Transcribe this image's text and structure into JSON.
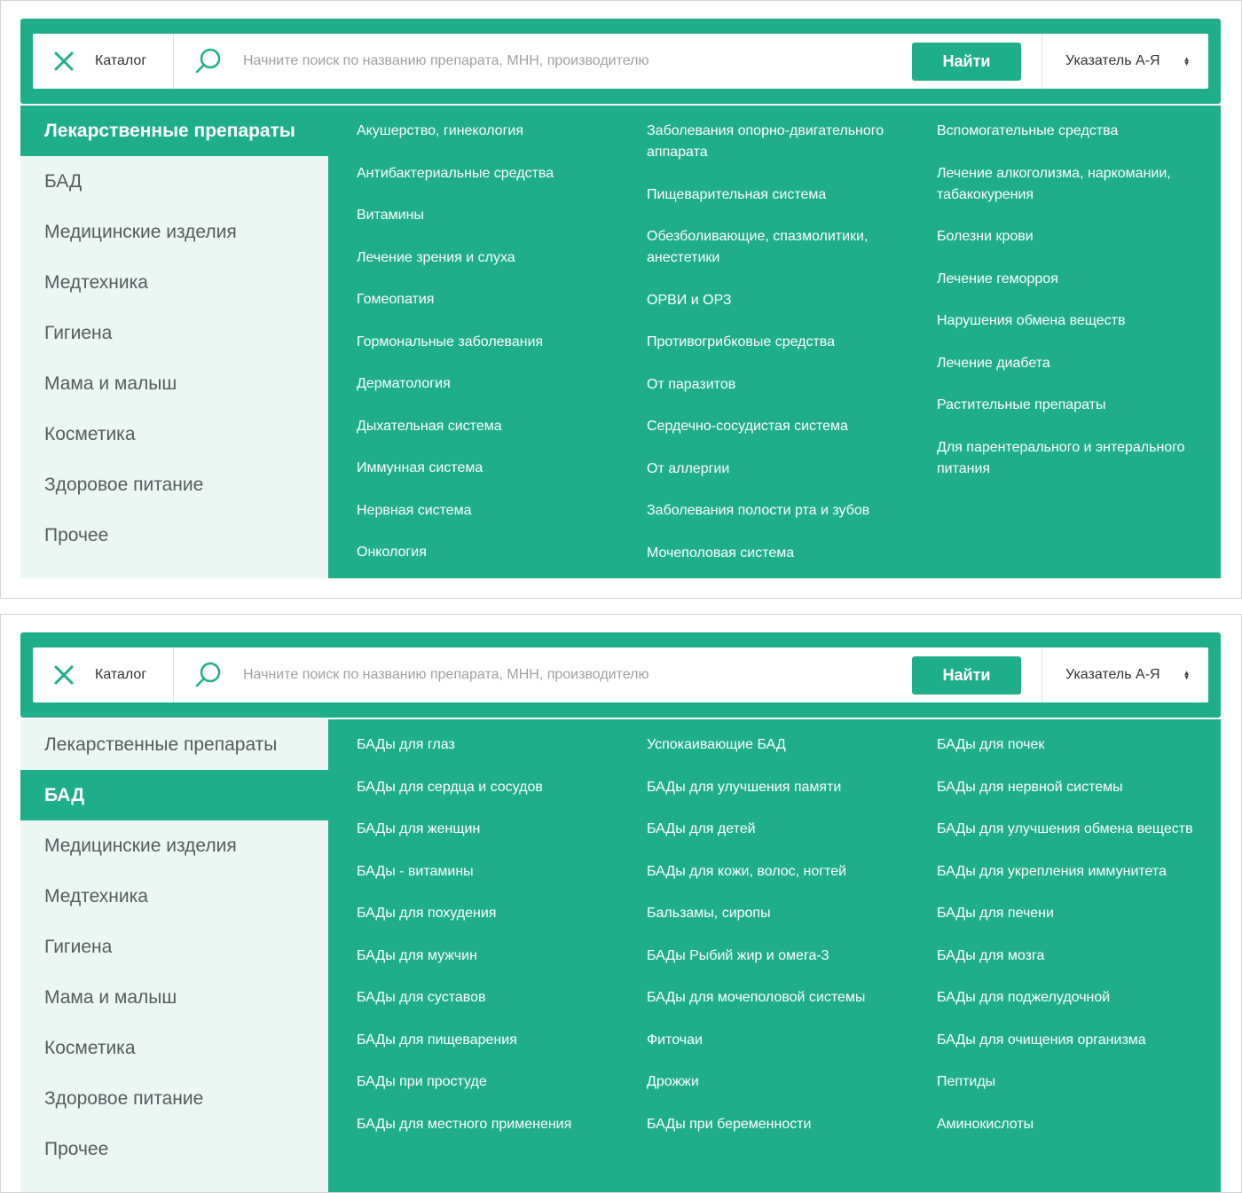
{
  "search_bar": {
    "catalog_label": "Каталог",
    "search_placeholder": "Начните поиск по названию препарата, МНН, производителю",
    "find_button": "Найти",
    "index_label": "Указатель А-Я"
  },
  "colors": {
    "accent": "#1fae8a",
    "sidebar_bg": "#ecf6f3",
    "sidebar_text": "#555d5b"
  },
  "categories": [
    "Лекарственные препараты",
    "БАД",
    "Медицинские изделия",
    "Медтехника",
    "Гигиена",
    "Мама и малыш",
    "Косметика",
    "Здоровое питание",
    "Прочее"
  ],
  "panels": [
    {
      "active_category": "Лекарственные препараты",
      "columns": [
        [
          "Акушерство, гинекология",
          "Антибактериальные средства",
          "Витамины",
          "Лечение зрения и слуха",
          "Гомеопатия",
          "Гормональные заболевания",
          "Дерматология",
          "Дыхательная система",
          "Иммунная система",
          "Нервная система",
          "Онкология"
        ],
        [
          "Заболевания опорно-двигательного аппарата",
          "Пищеварительная система",
          "Обезболивающие, спазмолитики, анестетики",
          "ОРВИ и ОРЗ",
          "Противогрибковые средства",
          "От паразитов",
          "Сердечно-сосудистая система",
          "От аллергии",
          "Заболевания полости рта и зубов",
          "Мочеполовая система"
        ],
        [
          "Вспомогательные средства",
          "Лечение алкоголизма, наркомании, табакокурения",
          "Болезни крови",
          "Лечение геморроя",
          "Нарушения обмена веществ",
          "Лечение диабета",
          "Растительные препараты",
          "Для парентерального и энтерального питания"
        ]
      ]
    },
    {
      "active_category": "БАД",
      "columns": [
        [
          "БАДы для глаз",
          "БАДы для сердца и сосудов",
          "БАДы для женщин",
          "БАДы - витамины",
          "БАДы для похудения",
          "БАДы для мужчин",
          "БАДы для суставов",
          "БАДы для пищеварения",
          "БАДы при простуде",
          "БАДы для местного применения"
        ],
        [
          "Успокаивающие БАД",
          "БАДы для улучшения памяти",
          "БАДы для детей",
          "БАДы для кожи, волос, ногтей",
          "Бальзамы, сиропы",
          "БАДы Рыбий жир и омега-3",
          "БАДы для мочеполовой системы",
          "Фиточаи",
          "Дрожжи",
          "БАДы при беременности"
        ],
        [
          "БАДы для почек",
          "БАДы для нервной системы",
          "БАДы для улучшения обмена веществ",
          "БАДы для укрепления иммунитета",
          "БАДы для печени",
          "БАДы для мозга",
          "БАДы для поджелудочной",
          "БАДы для очищения организма",
          "Пептиды",
          "Аминокислоты"
        ]
      ]
    }
  ]
}
